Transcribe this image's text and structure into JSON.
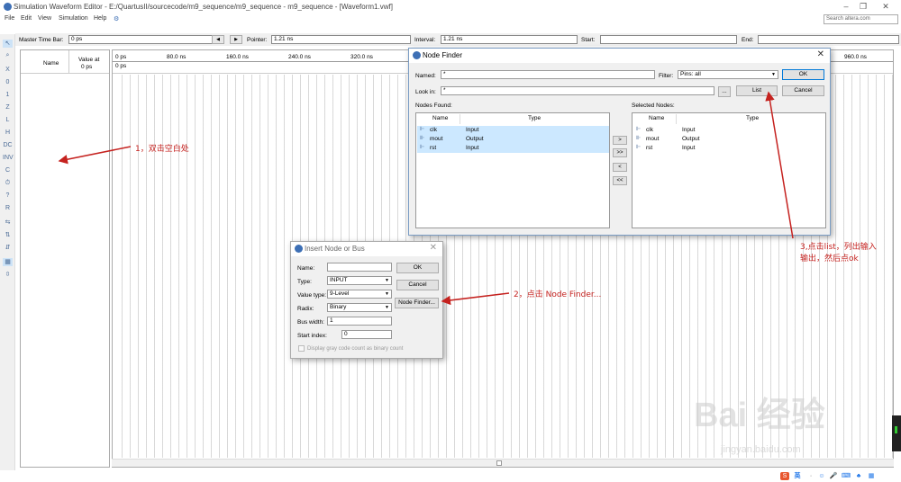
{
  "window": {
    "title": "Simulation Waveform Editor - E:/QuartusII/sourcecode/m9_sequence/m9_sequence - m9_sequence - [Waveform1.vwf]",
    "controls": [
      "–",
      "❐",
      "✕"
    ]
  },
  "menu": {
    "items": [
      "File",
      "Edit",
      "View",
      "Simulation",
      "Help"
    ],
    "search_placeholder": "Search altera.com"
  },
  "timebar": {
    "master_label": "Master Time Bar:",
    "master_value": "0 ps",
    "pointer_label": "Pointer:",
    "pointer_value": "1.21 ns",
    "interval_label": "Interval:",
    "interval_value": "1.21 ns",
    "start_label": "Start:",
    "start_value": "",
    "end_label": "End:",
    "end_value": ""
  },
  "name_panel": {
    "col_name": "Name",
    "col_value": "Value at",
    "col_value2": "0 ps"
  },
  "timeline": {
    "ticks": [
      "0 ps",
      "80.0 ns",
      "160.0 ns",
      "240.0 ns",
      "320.0 ns",
      "960.0 ns"
    ],
    "marker": "0 ps"
  },
  "node_finder": {
    "title": "Node Finder",
    "named_label": "Named:",
    "named_value": "*",
    "filter_label": "Filter:",
    "filter_value": "Pins: all",
    "ok_label": "OK",
    "lookin_label": "Look in:",
    "lookin_value": "*",
    "browse_label": "...",
    "list_label": "List",
    "cancel_label": "Cancel",
    "nodes_found_label": "Nodes Found:",
    "selected_nodes_label": "Selected Nodes:",
    "col_name": "Name",
    "col_type": "Type",
    "nodes_found": [
      {
        "name": "clk",
        "type": "Input"
      },
      {
        "name": "mout",
        "type": "Output"
      },
      {
        "name": "rst",
        "type": "Input"
      }
    ],
    "selected_nodes": [
      {
        "name": "clk",
        "type": "Input"
      },
      {
        "name": "mout",
        "type": "Output"
      },
      {
        "name": "rst",
        "type": "Input"
      }
    ],
    "move_buttons": [
      ">",
      ">>",
      "<",
      "<<"
    ]
  },
  "insert_node": {
    "title": "Insert Node or Bus",
    "name_label": "Name:",
    "name_value": "",
    "type_label": "Type:",
    "type_value": "INPUT",
    "valuetype_label": "Value type:",
    "valuetype_value": "9-Level",
    "radix_label": "Radix:",
    "radix_value": "Binary",
    "buswidth_label": "Bus width:",
    "buswidth_value": "1",
    "startindex_label": "Start index:",
    "startindex_value": "0",
    "graycode_label": "Display gray code count as binary count",
    "ok_label": "OK",
    "cancel_label": "Cancel",
    "nodefinder_label": "Node Finder..."
  },
  "annotations": {
    "step1": "1，双击空白处",
    "step2": "2，点击 Node Finder...",
    "step3_line1": "3,点击list，列出输入",
    "step3_line2": "输出，然后点ok"
  },
  "watermark": {
    "brand": "Bai 经验",
    "url": "jingyan.baidu.com"
  },
  "tray": {
    "ime": "英"
  },
  "colors": {
    "annotation": "#c5221f",
    "selection": "#cce8ff",
    "dialog_border": "#7a9cc4"
  }
}
